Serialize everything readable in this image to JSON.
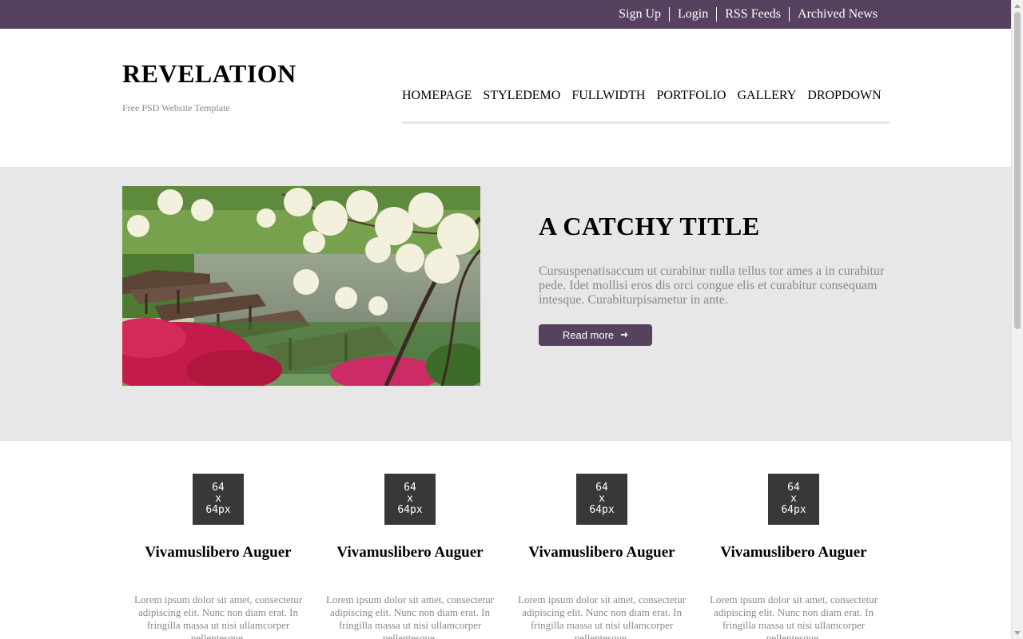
{
  "topbar": {
    "links": [
      "Sign Up",
      "Login",
      "RSS Feeds",
      "Archived News"
    ]
  },
  "header": {
    "logo": "REVELATION",
    "tagline": "Free PSD Website Template",
    "nav": [
      "HOMEPAGE",
      "STYLEDEMO",
      "FULLWIDTH",
      "PORTFOLIO",
      "GALLERY",
      "DROPDOWN"
    ]
  },
  "hero": {
    "title": "A CATCHY TITLE",
    "text": "Cursuspenatisaccum ut curabitur nulla tellus tor ames a in curabitur pede. Idet mollisi eros dis orci congue elis et curabitur consequam intesque. Curabiturpisametur in ante.",
    "button_label": "Read more",
    "button_icon": "arrow-right-icon"
  },
  "features": [
    {
      "placeholder": [
        "64",
        "x",
        "64px"
      ],
      "title": "Vivamuslibero Auguer",
      "text": "Lorem ipsum dolor sit amet, consectetur adipiscing elit. Nunc non diam erat. In fringilla massa ut nisi ullamcorper pellentesque."
    },
    {
      "placeholder": [
        "64",
        "x",
        "64px"
      ],
      "title": "Vivamuslibero Auguer",
      "text": "Lorem ipsum dolor sit amet, consectetur adipiscing elit. Nunc non diam erat. In fringilla massa ut nisi ullamcorper pellentesque."
    },
    {
      "placeholder": [
        "64",
        "x",
        "64px"
      ],
      "title": "Vivamuslibero Auguer",
      "text": "Lorem ipsum dolor sit amet, consectetur adipiscing elit. Nunc non diam erat. In fringilla massa ut nisi ullamcorper pellentesque."
    },
    {
      "placeholder": [
        "64",
        "x",
        "64px"
      ],
      "title": "Vivamuslibero Auguer",
      "text": "Lorem ipsum dolor sit amet, consectetur adipiscing elit. Nunc non diam erat. In fringilla massa ut nisi ullamcorper pellentesque."
    }
  ],
  "colors": {
    "brand": "#56415f",
    "hero_bg": "#e8e7e7",
    "placeholder_bg": "#383838",
    "muted_text": "#888888"
  }
}
